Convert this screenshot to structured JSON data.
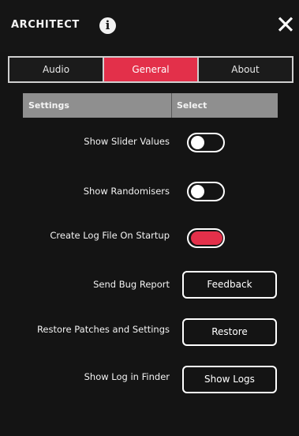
{
  "app": {
    "title": "ARCHITECT"
  },
  "tabs": [
    {
      "label": "Audio",
      "active": false
    },
    {
      "label": "General",
      "active": true
    },
    {
      "label": "About",
      "active": false
    }
  ],
  "table": {
    "col_settings": "Settings",
    "col_select": "Select"
  },
  "settings": [
    {
      "label": "Show Slider Values",
      "control": "toggle",
      "on": false
    },
    {
      "label": "Show Randomisers",
      "control": "toggle",
      "on": false
    },
    {
      "label": "Create Log File On Startup",
      "control": "toggle",
      "on": true
    },
    {
      "label": "Send Bug Report",
      "control": "button",
      "button_label": "Feedback"
    },
    {
      "label": "Restore Patches and Settings",
      "control": "button",
      "button_label": "Restore"
    },
    {
      "label": "Show Log in Finder",
      "control": "button",
      "button_label": "Show Logs"
    }
  ],
  "icons": {
    "info": "info-icon",
    "close": "close-icon"
  },
  "colors": {
    "accent": "#e3304a",
    "background": "#141414",
    "header_bar": "#8f8f8f"
  }
}
